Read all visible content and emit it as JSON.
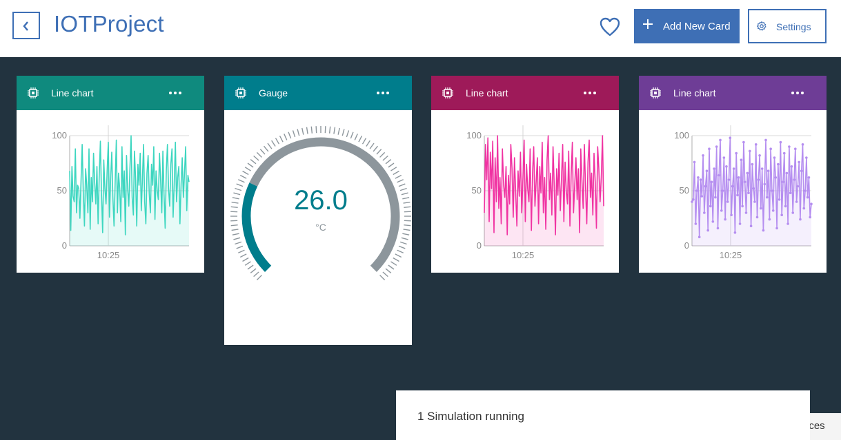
{
  "header": {
    "title": "IOTProject",
    "add_label": "Add New Card",
    "settings_label": "Settings",
    "accent_color": "#3e6fb5"
  },
  "cards": [
    {
      "title": "Line chart",
      "color": "#0f8a7e",
      "chart_data": {
        "type": "area",
        "series": [
          {
            "color": "#3ed6c0",
            "values": [
              68,
              14,
              72,
              45,
              40,
              88,
              30,
              55,
              52,
              25,
              60,
              92,
              48,
              18,
              70,
              55,
              30,
              88,
              15,
              62,
              40,
              84,
              58,
              38,
              72,
              20,
              64,
              95,
              48,
              12,
              78,
              52,
              38,
              70,
              94,
              26,
              60,
              85,
              44,
              18,
              58,
              96,
              30,
              66,
              52,
              22,
              90,
              44,
              68,
              10,
              82,
              52,
              36,
              70,
              100,
              44,
              28,
              86,
              60,
              18,
              74,
              55,
              84,
              32,
              60,
              92,
              40,
              20,
              66,
              82,
              48,
              30,
              74,
              55,
              90,
              24,
              68,
              50,
              42,
              84,
              60,
              30,
              86,
              46,
              16,
              68,
              92,
              52,
              36,
              74,
              88,
              26,
              58,
              94,
              40,
              62,
              72,
              20,
              56,
              80,
              44,
              66,
              90,
              32,
              64,
              58
            ]
          }
        ],
        "ylim": [
          0,
          100
        ],
        "yticks": [
          "100",
          "50",
          "0"
        ],
        "xtick": "10:25"
      }
    },
    {
      "title": "Gauge",
      "color": "#007d8c",
      "gauge": {
        "value": "26.0",
        "value_number": 26,
        "unit": "°C",
        "min": 0,
        "max": 100,
        "value_color": "#007d8c",
        "track_color": "#8d969c"
      }
    },
    {
      "title": "Line chart",
      "color": "#9e1a59",
      "chart_data": {
        "type": "area",
        "series": [
          {
            "color": "#f033a2",
            "values": [
              30,
              92,
              60,
              98,
              22,
              85,
              52,
              95,
              12,
              80,
              40,
              100,
              34,
              62,
              20,
              88,
              55,
              44,
              72,
              10,
              64,
              38,
              92,
              70,
              26,
              80,
              50,
              18,
              68,
              45,
              85,
              30,
              60,
              96,
              22,
              74,
              52,
              40,
              88,
              14,
              66,
              90,
              36,
              58,
              80,
              20,
              72,
              48,
              94,
              30,
              62,
              15,
              78,
              100,
              42,
              66,
              28,
              90,
              54,
              10,
              70,
              46,
              84,
              32,
              60,
              92,
              22,
              76,
              50,
              38,
              86,
              18,
              64,
              94,
              30,
              56,
              80,
              42,
              70,
              12,
              88,
              60,
              34,
              92,
              52,
              20,
              76,
              96,
              44,
              66,
              28,
              84,
              58,
              16,
              90,
              70,
              40,
              62,
              100,
              36
            ]
          }
        ],
        "ylim": [
          0,
          100
        ],
        "yticks": [
          "100",
          "50",
          "0"
        ],
        "xtick": "10:25"
      }
    },
    {
      "title": "Line chart",
      "color": "#6e3d96",
      "chart_data": {
        "type": "line",
        "series": [
          {
            "color": "#b58ef0",
            "values": [
              40,
              42,
              76,
              20,
              50,
              62,
              8,
              60,
              45,
              82,
              30,
              54,
              68,
              14,
              88,
              36,
              58,
              22,
              70,
              44,
              90,
              16,
              64,
              96,
              32,
              50,
              80,
              24,
              72,
              40,
              60,
              98,
              28,
              54,
              70,
              12,
              84,
              46,
              62,
              20,
              78,
              36,
              94,
              58,
              30,
              66,
              48,
              86,
              18,
              74,
              52,
              40,
              92,
              26,
              60,
              82,
              34,
              70,
              14,
              56,
              96,
              44,
              68,
              24,
              88,
              50,
              32,
              80,
              62,
              16,
              74,
              42,
              94,
              28,
              58,
              84,
              36,
              66,
              20,
              90,
              48,
              72,
              30,
              60,
              88,
              40,
              54,
              76,
              24,
              68,
              92,
              34,
              50,
              80,
              44,
              62,
              26,
              38
            ]
          }
        ],
        "ylim": [
          0,
          100
        ],
        "yticks": [
          "100",
          "50",
          "0"
        ],
        "xtick": "10:25"
      }
    }
  ],
  "toast": {
    "text": "1 Simulation running"
  },
  "peek": {
    "text": "nces"
  }
}
